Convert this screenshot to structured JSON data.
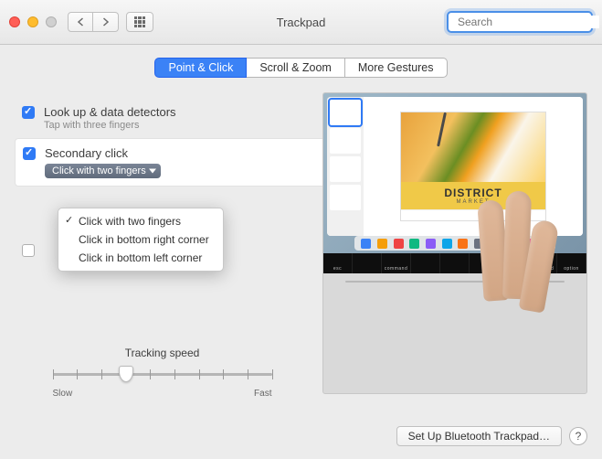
{
  "window": {
    "title": "Trackpad"
  },
  "search": {
    "placeholder": "Search",
    "value": ""
  },
  "tabs": {
    "items": [
      "Point & Click",
      "Scroll & Zoom",
      "More Gestures"
    ],
    "active": 0
  },
  "settings": {
    "lookup": {
      "checked": true,
      "label": "Look up & data detectors",
      "sub": "Tap with three fingers"
    },
    "secondary": {
      "checked": true,
      "label": "Secondary click",
      "selected": "Click with two fingers",
      "options": [
        "Click with two fingers",
        "Click in bottom right corner",
        "Click in bottom left corner"
      ]
    },
    "third": {
      "checked": false
    }
  },
  "tracking": {
    "label": "Tracking speed",
    "min_label": "Slow",
    "max_label": "Fast",
    "ticks": 10,
    "value": 3
  },
  "preview": {
    "poster_title": "DISTRICT",
    "poster_sub": "MARKET",
    "touchbar_keys": [
      "esc",
      "",
      "command",
      "",
      "",
      "",
      "",
      "command",
      "option"
    ],
    "dock_colors": [
      "#3b82f6",
      "#f59e0b",
      "#ef4444",
      "#10b981",
      "#8b5cf6",
      "#0ea5e9",
      "#f97316",
      "#6b7280",
      "#ffffff",
      "#14b8a6",
      "#ec4899",
      "#a3a3a3"
    ]
  },
  "footer": {
    "setup": "Set Up Bluetooth Trackpad…",
    "help": "?"
  }
}
